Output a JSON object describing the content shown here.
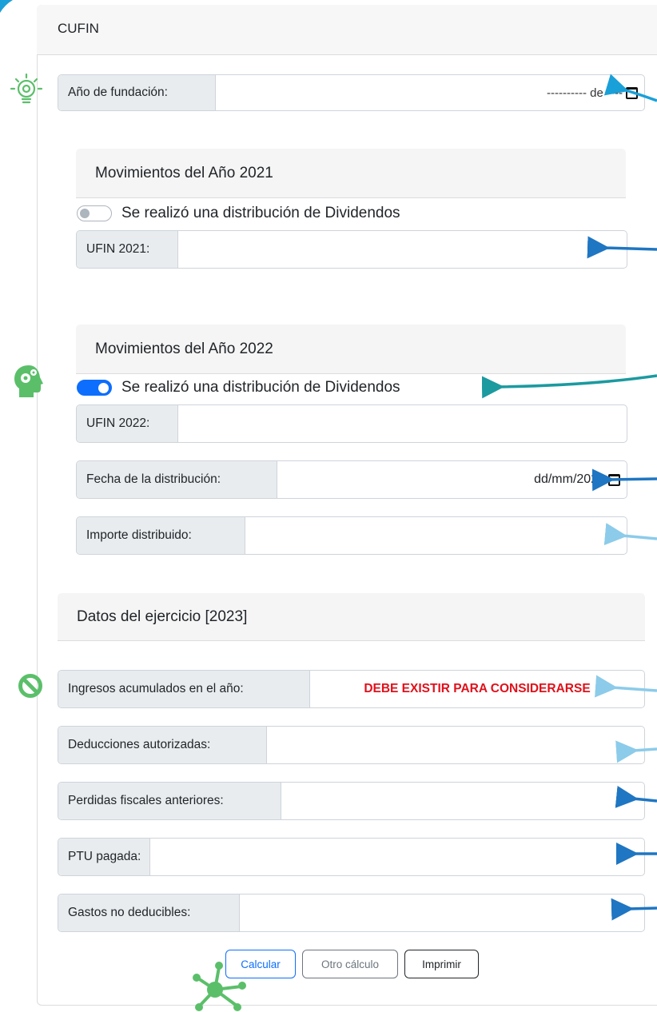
{
  "card": {
    "title": "CUFIN"
  },
  "fundacion": {
    "label": "Año de fundación:",
    "value": "---------- de ----"
  },
  "mov2021": {
    "header": "Movimientos del Año 2021",
    "switch_label": "Se realizó una distribución de Dividendos",
    "switch_on": false,
    "ufin_label": "UFIN 2021:"
  },
  "mov2022": {
    "header": "Movimientos del Año 2022",
    "switch_label": "Se realizó una distribución de Dividendos",
    "switch_on": true,
    "ufin_label": "UFIN 2022:",
    "fecha_label": "Fecha de la distribución:",
    "fecha_value": "dd/mm/2022",
    "importe_label": "Importe distribuido:"
  },
  "ejercicio": {
    "header": "Datos del ejercicio [2023]",
    "ingresos_label": "Ingresos acumulados en el año:",
    "ingresos_warning": "DEBE EXISTIR PARA CONSIDERARSE",
    "deducciones_label": "Deducciones autorizadas:",
    "perdidas_label": "Perdidas fiscales anteriores:",
    "ptu_label": "PTU pagada:",
    "gastos_label": "Gastos no deducibles:"
  },
  "buttons": {
    "calcular": "Calcular",
    "otro": "Otro cálculo",
    "imprimir": "Imprimir"
  },
  "icons": [
    "lightbulb-icon",
    "head-gears-icon",
    "no-entry-icon",
    "network-icon",
    "calendar-icon",
    "arrow-icon"
  ],
  "colors": {
    "primary": "#0d6efd",
    "warning": "#e0111b",
    "accent_green": "#5bbf6a",
    "arrow_blue": "#1f76c2",
    "arrow_teal": "#1b9aa0",
    "arrow_light": "#8ccbea"
  }
}
